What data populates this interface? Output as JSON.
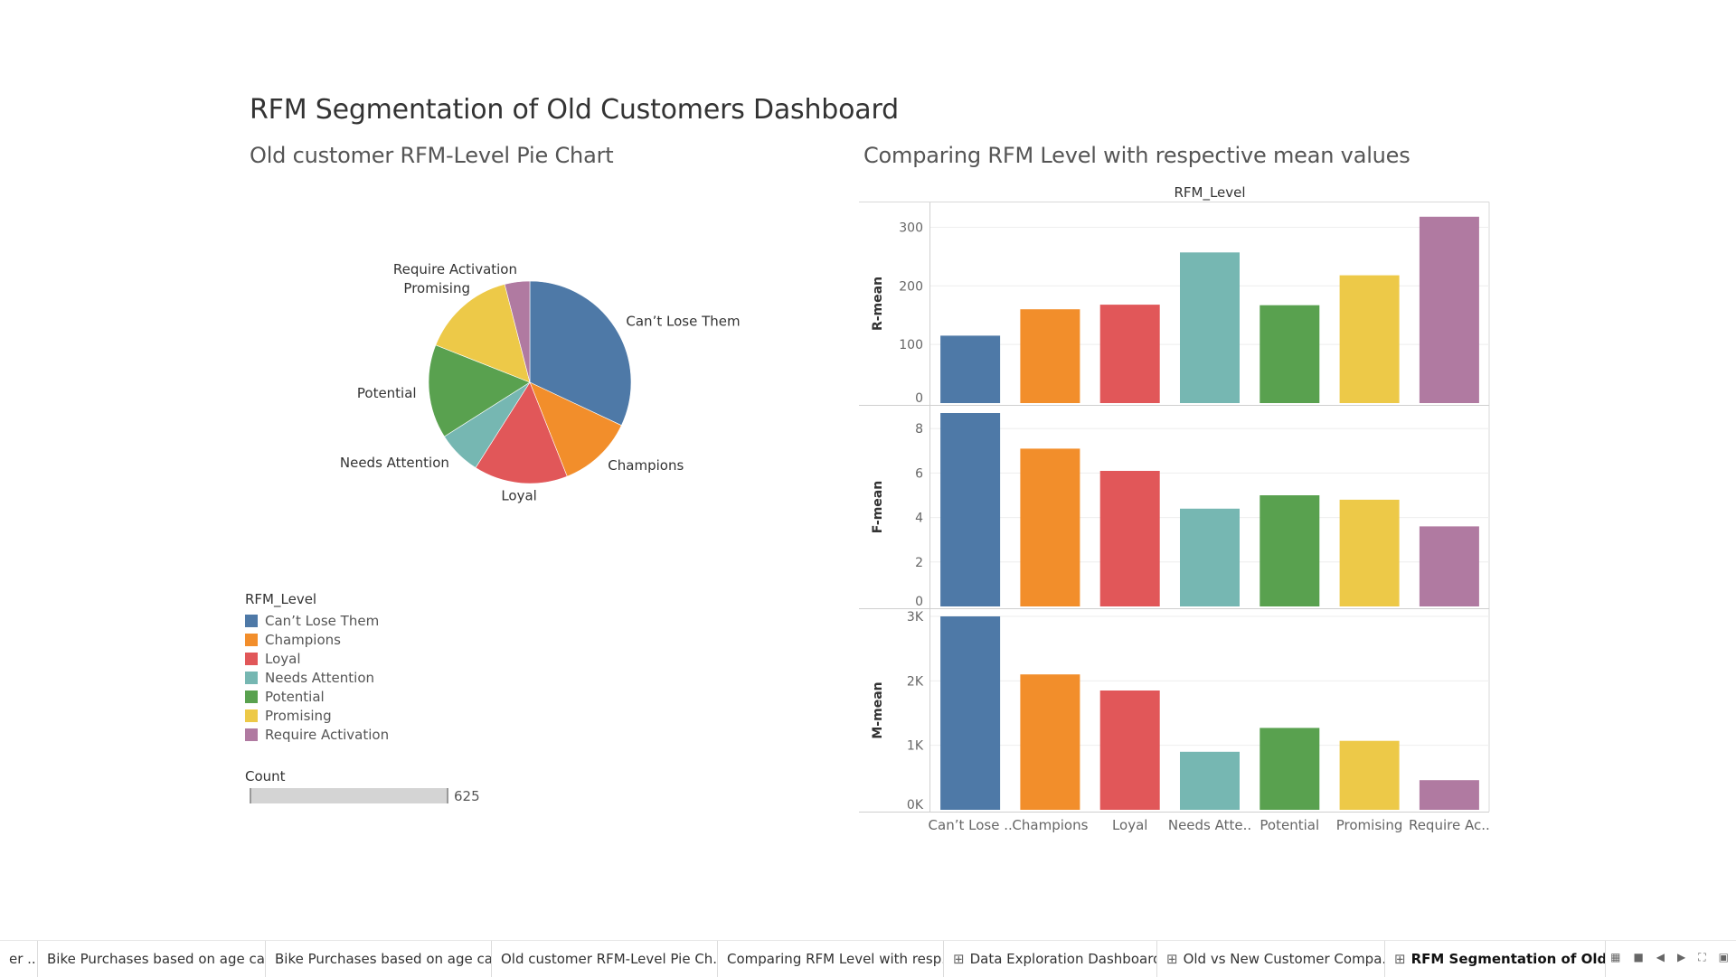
{
  "dashboard": {
    "title": "RFM Segmentation of Old Customers Dashboard",
    "pie_title": "Old customer RFM-Level Pie Chart",
    "bar_title": "Comparing RFM Level with respective mean values"
  },
  "colors": {
    "Can't Lose Them": "#4e79a7",
    "Champions": "#f28e2b",
    "Loyal": "#e15759",
    "Needs Attention": "#76b7b2",
    "Potential": "#59a14f",
    "Promising": "#edc948",
    "Require Activation": "#b07aa1"
  },
  "legend": {
    "title": "RFM_Level",
    "items": [
      {
        "label": "Can’t Lose Them",
        "color": "#4e79a7"
      },
      {
        "label": "Champions",
        "color": "#f28e2b"
      },
      {
        "label": "Loyal",
        "color": "#e15759"
      },
      {
        "label": "Needs Attention",
        "color": "#76b7b2"
      },
      {
        "label": "Potential",
        "color": "#59a14f"
      },
      {
        "label": "Promising",
        "color": "#edc948"
      },
      {
        "label": "Require Activation",
        "color": "#b07aa1"
      }
    ]
  },
  "count": {
    "title": "Count",
    "value": "625"
  },
  "chart_data": [
    {
      "type": "pie",
      "title": "Old customer RFM-Level Pie Chart",
      "slices": [
        {
          "label": "Can’t Lose Them",
          "value": 32,
          "color": "#4e79a7"
        },
        {
          "label": "Champions",
          "value": 12,
          "color": "#f28e2b"
        },
        {
          "label": "Loyal",
          "value": 15,
          "color": "#e15759"
        },
        {
          "label": "Needs Attention",
          "value": 7,
          "color": "#76b7b2"
        },
        {
          "label": "Potential",
          "value": 15,
          "color": "#59a14f"
        },
        {
          "label": "Promising",
          "value": 15,
          "color": "#edc948"
        },
        {
          "label": "Require Activation",
          "value": 4,
          "color": "#b07aa1"
        }
      ]
    },
    {
      "type": "bar",
      "title": "Comparing RFM Level with respective mean values",
      "column_header": "RFM_Level",
      "categories": [
        "Can't Lose Them",
        "Champions",
        "Loyal",
        "Needs Attention",
        "Potential",
        "Promising",
        "Require Activation"
      ],
      "category_tick_labels": [
        "Can’t Lose ..",
        "Champions",
        "Loyal",
        "Needs Atte..",
        "Potential",
        "Promising",
        "Require Ac.."
      ],
      "colors": [
        "#4e79a7",
        "#f28e2b",
        "#e15759",
        "#76b7b2",
        "#59a14f",
        "#edc948",
        "#b07aa1"
      ],
      "panels": [
        {
          "name": "R-mean",
          "ylabel": "R-mean",
          "ylim": [
            0,
            330
          ],
          "ticks": [
            0,
            100,
            200,
            300
          ],
          "tick_labels": [
            "0",
            "100",
            "200",
            "300"
          ],
          "values": [
            115,
            160,
            168,
            257,
            167,
            218,
            318
          ]
        },
        {
          "name": "F-mean",
          "ylabel": "F-mean",
          "ylim": [
            0,
            8.7
          ],
          "ticks": [
            0,
            2,
            4,
            6,
            8
          ],
          "tick_labels": [
            "0",
            "2",
            "4",
            "6",
            "8"
          ],
          "values": [
            8.7,
            7.1,
            6.1,
            4.4,
            5.0,
            4.8,
            3.6
          ]
        },
        {
          "name": "M-mean",
          "ylabel": "M-mean",
          "ylim": [
            0,
            3000
          ],
          "ticks": [
            0,
            1000,
            2000,
            3000
          ],
          "tick_labels": [
            "0K",
            "1K",
            "2K",
            "3K"
          ],
          "values": [
            3000,
            2100,
            1850,
            900,
            1270,
            1070,
            460
          ]
        }
      ]
    }
  ],
  "tabs": [
    {
      "label": "er ...",
      "icon": "",
      "active": false
    },
    {
      "label": "Bike Purchases based on age ca...",
      "icon": "",
      "active": false
    },
    {
      "label": "Bike Purchases based on age ca...",
      "icon": "",
      "active": false
    },
    {
      "label": "Old customer RFM-Level Pie Ch...",
      "icon": "",
      "active": false
    },
    {
      "label": "Comparing RFM Level with resp...",
      "icon": "",
      "active": false
    },
    {
      "label": "Data Exploration Dashboard",
      "icon": "⊞",
      "active": false
    },
    {
      "label": "Old vs New Customer Compa...",
      "icon": "⊞",
      "active": false
    },
    {
      "label": "RFM Segmentation of Old C...",
      "icon": "⊞",
      "active": true
    }
  ],
  "nav_icons": [
    "grid-view-icon",
    "filmstrip-icon",
    "prev-sheet-icon",
    "next-sheet-icon",
    "fullscreen-icon",
    "present-icon"
  ]
}
